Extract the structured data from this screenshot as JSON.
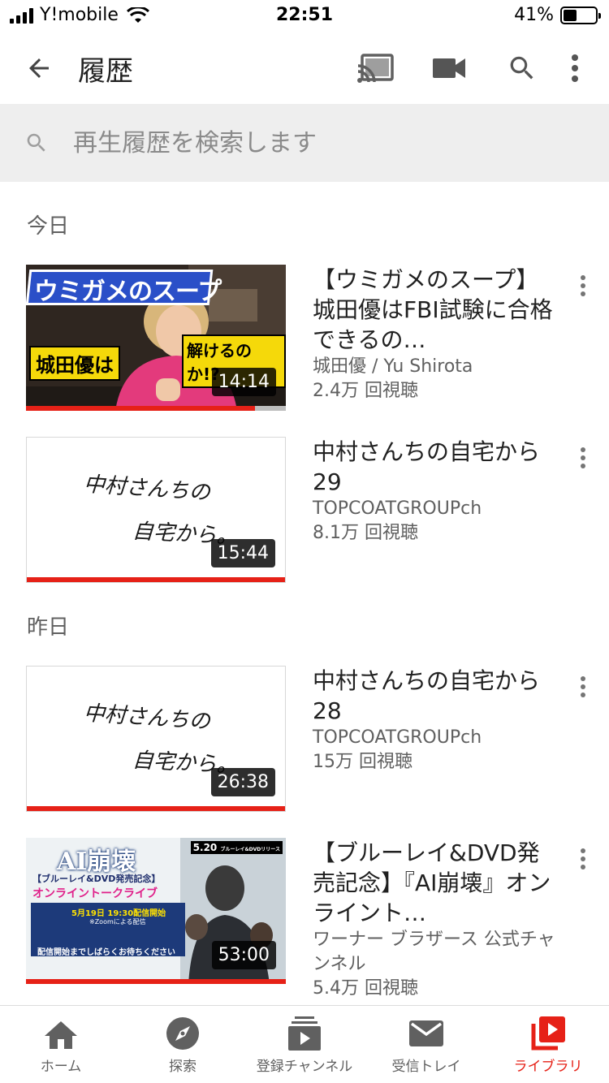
{
  "status_bar": {
    "carrier": "Y!mobile",
    "time": "22:51",
    "battery": "41%",
    "battery_level": 0.41
  },
  "header": {
    "title": "履歴"
  },
  "search": {
    "placeholder": "再生履歴を検索します"
  },
  "sections": [
    {
      "header": "今日",
      "videos": [
        {
          "title": "【ウミガメのスープ】城田優はFBI試験に合格できるの…",
          "channel": "城田優 / Yu Shirota",
          "views": "2.4万 回視聴",
          "duration": "14:14",
          "watched": 0.88,
          "thumb_text": {
            "banner": "ウミガメのスープ",
            "left": "城田優は",
            "right": "解けるのか!?"
          }
        },
        {
          "title": "中村さんちの自宅から29",
          "channel": "TOPCOATGROUPch",
          "views": "8.1万 回視聴",
          "duration": "15:44",
          "watched": 1.0,
          "thumb_text": {
            "line1": "中村さんちの",
            "line2": "自宅から。"
          }
        }
      ]
    },
    {
      "header": "昨日",
      "videos": [
        {
          "title": "中村さんちの自宅から28",
          "channel": "TOPCOATGROUPch",
          "views": "15万 回視聴",
          "duration": "26:38",
          "watched": 1.0,
          "thumb_text": {
            "line1": "中村さんちの",
            "line2": "自宅から。"
          }
        },
        {
          "title": "【ブルーレイ&DVD発売記念】『AI崩壊』オンライント…",
          "channel": "ワーナー ブラザース 公式チャンネル",
          "views": "5.4万 回視聴",
          "duration": "53:00",
          "watched": 1.0,
          "thumb_text": {
            "badge": "5.20",
            "badge_sub": "ブルーレイ&DVDリリース",
            "title": "AI崩壊",
            "sub1": "【ブルーレイ&DVD発売記念】",
            "sub2": "オンライントークライブ",
            "date": "5月19日 19:30配信開始",
            "zoom": "※Zoomによる配信",
            "footer": "配信開始までしばらくお待ちください"
          }
        }
      ]
    }
  ],
  "bottom_nav": [
    {
      "label": "ホーム",
      "icon": "home-icon"
    },
    {
      "label": "探索",
      "icon": "compass-icon"
    },
    {
      "label": "登録チャンネル",
      "icon": "subscriptions-icon"
    },
    {
      "label": "受信トレイ",
      "icon": "inbox-icon"
    },
    {
      "label": "ライブラリ",
      "icon": "library-icon",
      "active": true
    }
  ],
  "colors": {
    "accent": "#e62117",
    "search_bg": "#eeeeee",
    "text_secondary": "#606060"
  }
}
